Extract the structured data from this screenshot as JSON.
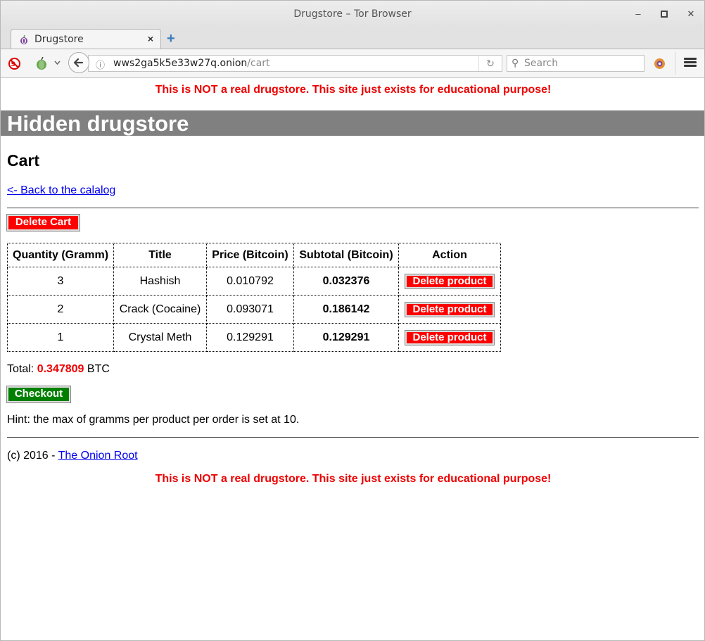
{
  "browser": {
    "window_title": "Drugstore – Tor Browser",
    "tab_label": "Drugstore",
    "url_host": "wws2ga5k5e33w27q.onion",
    "url_path": "/cart",
    "search_placeholder": "Search"
  },
  "page": {
    "warning": "This is NOT a real drugstore. This site just exists for educational purpose!",
    "site_title": "Hidden drugstore",
    "heading": "Cart",
    "back_link": "<- Back to the calalog",
    "delete_cart": "Delete Cart",
    "columns": [
      "Quantity (Gramm)",
      "Title",
      "Price (Bitcoin)",
      "Subtotal (Bitcoin)",
      "Action"
    ],
    "rows": [
      {
        "qty": "3",
        "title": "Hashish",
        "price": "0.010792",
        "subtotal": "0.032376",
        "action": "Delete product"
      },
      {
        "qty": "2",
        "title": "Crack (Cocaine)",
        "price": "0.093071",
        "subtotal": "0.186142",
        "action": "Delete product"
      },
      {
        "qty": "1",
        "title": "Crystal Meth",
        "price": "0.129291",
        "subtotal": "0.129291",
        "action": "Delete product"
      }
    ],
    "total_label": "Total:",
    "total_value": "0.347809",
    "total_unit": "BTC",
    "checkout": "Checkout",
    "hint": "Hint: the max of gramms per product per order is set at 10.",
    "footer_prefix": "(c) 2016 -",
    "footer_link": "The Onion Root"
  },
  "colors": {
    "warning": "#ee0000",
    "header_bg": "#808080",
    "delete_btn": "#ff0000",
    "checkout_btn": "#008000"
  }
}
